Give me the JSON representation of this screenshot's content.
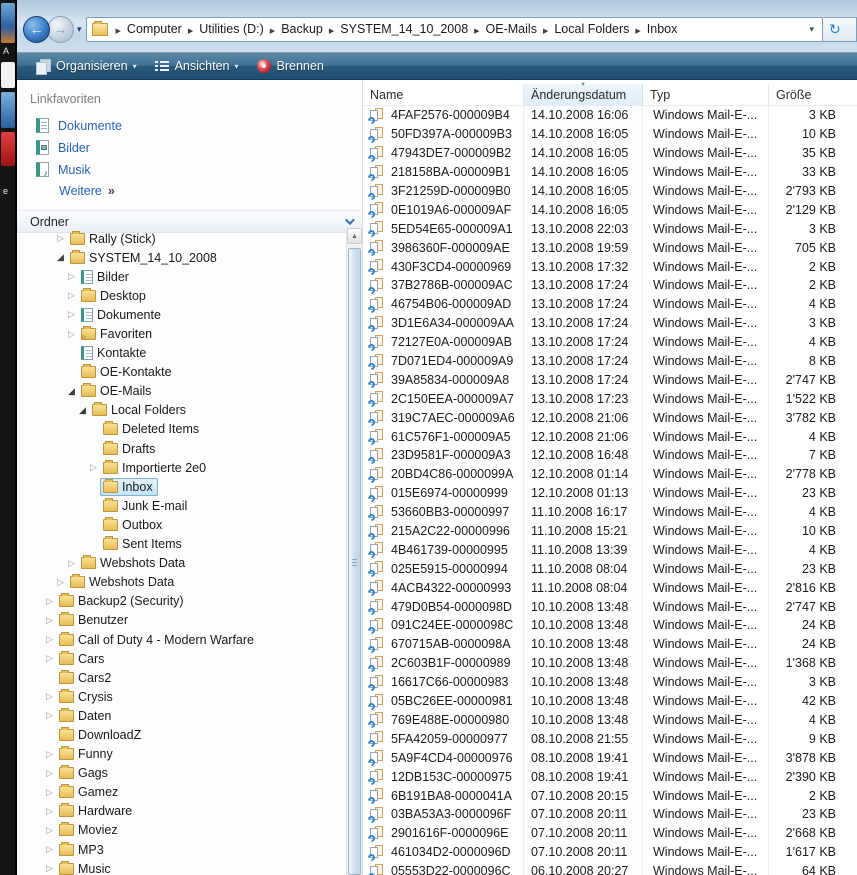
{
  "window": {
    "breadcrumb": {
      "segments": [
        "Computer",
        "Utilities (D:)",
        "Backup",
        "SYSTEM_14_10_2008",
        "OE-Mails",
        "Local Folders",
        "Inbox"
      ]
    },
    "toolbar": {
      "organize_label": "Organisieren",
      "views_label": "Ansichten",
      "burn_label": "Brennen"
    }
  },
  "sidebar": {
    "favorites_title": "Linkfavoriten",
    "favorites": [
      {
        "label": "Dokumente",
        "icon": "documents-icon"
      },
      {
        "label": "Bilder",
        "icon": "pictures-icon"
      },
      {
        "label": "Musik",
        "icon": "music-icon"
      }
    ],
    "more_label": "Weitere",
    "more_glyph": "»",
    "folders_title": "Ordner",
    "tree": [
      {
        "label": "Rally (Stick)",
        "depth": 1,
        "state": "collapsed",
        "icon": "folder"
      },
      {
        "label": "SYSTEM_14_10_2008",
        "depth": 1,
        "state": "expanded",
        "icon": "folder"
      },
      {
        "label": "Bilder",
        "depth": 2,
        "state": "collapsed",
        "icon": "page"
      },
      {
        "label": "Desktop",
        "depth": 2,
        "state": "collapsed",
        "icon": "folder"
      },
      {
        "label": "Dokumente",
        "depth": 2,
        "state": "collapsed",
        "icon": "page"
      },
      {
        "label": "Favoriten",
        "depth": 2,
        "state": "collapsed",
        "icon": "folder-star"
      },
      {
        "label": "Kontakte",
        "depth": 2,
        "state": "none",
        "icon": "page"
      },
      {
        "label": "OE-Kontakte",
        "depth": 2,
        "state": "none",
        "icon": "folder"
      },
      {
        "label": "OE-Mails",
        "depth": 2,
        "state": "expanded",
        "icon": "folder"
      },
      {
        "label": "Local Folders",
        "depth": 3,
        "state": "expanded",
        "icon": "folder"
      },
      {
        "label": "Deleted Items",
        "depth": 4,
        "state": "none",
        "icon": "folder"
      },
      {
        "label": "Drafts",
        "depth": 4,
        "state": "none",
        "icon": "folder"
      },
      {
        "label": "Importierte 2e0",
        "depth": 4,
        "state": "collapsed",
        "icon": "folder"
      },
      {
        "label": "Inbox",
        "depth": 4,
        "state": "none",
        "icon": "folder",
        "selected": true
      },
      {
        "label": "Junk E-mail",
        "depth": 4,
        "state": "none",
        "icon": "folder"
      },
      {
        "label": "Outbox",
        "depth": 4,
        "state": "none",
        "icon": "folder"
      },
      {
        "label": "Sent Items",
        "depth": 4,
        "state": "none",
        "icon": "folder"
      },
      {
        "label": "Webshots Data",
        "depth": 2,
        "state": "collapsed",
        "icon": "folder"
      },
      {
        "label": "Webshots Data",
        "depth": 1,
        "state": "collapsed",
        "icon": "folder"
      },
      {
        "label": "Backup2 (Security)",
        "depth": 0,
        "state": "collapsed",
        "icon": "folder"
      },
      {
        "label": "Benutzer",
        "depth": 0,
        "state": "collapsed",
        "icon": "folder"
      },
      {
        "label": "Call of Duty 4 - Modern Warfare",
        "depth": 0,
        "state": "collapsed",
        "icon": "folder"
      },
      {
        "label": "Cars",
        "depth": 0,
        "state": "collapsed",
        "icon": "folder"
      },
      {
        "label": "Cars2",
        "depth": 0,
        "state": "none",
        "icon": "folder"
      },
      {
        "label": "Crysis",
        "depth": 0,
        "state": "collapsed",
        "icon": "folder"
      },
      {
        "label": "Daten",
        "depth": 0,
        "state": "collapsed",
        "icon": "folder"
      },
      {
        "label": "DownloadZ",
        "depth": 0,
        "state": "none",
        "icon": "folder"
      },
      {
        "label": "Funny",
        "depth": 0,
        "state": "collapsed",
        "icon": "folder"
      },
      {
        "label": "Gags",
        "depth": 0,
        "state": "collapsed",
        "icon": "folder"
      },
      {
        "label": "Gamez",
        "depth": 0,
        "state": "collapsed",
        "icon": "folder"
      },
      {
        "label": "Hardware",
        "depth": 0,
        "state": "collapsed",
        "icon": "folder"
      },
      {
        "label": "Moviez",
        "depth": 0,
        "state": "collapsed",
        "icon": "folder"
      },
      {
        "label": "MP3",
        "depth": 0,
        "state": "collapsed",
        "icon": "folder"
      },
      {
        "label": "Music",
        "depth": 0,
        "state": "collapsed",
        "icon": "folder"
      }
    ]
  },
  "filelist": {
    "columns": [
      "Name",
      "Änderungsdatum",
      "Typ",
      "Größe"
    ],
    "sorted_column": "Änderungsdatum",
    "sort_direction": "descending",
    "type_label": "Windows Mail-E-...",
    "rows": [
      {
        "name": "4FAF2576-000009B4",
        "date": "14.10.2008 16:06",
        "size": "3 KB"
      },
      {
        "name": "50FD397A-000009B3",
        "date": "14.10.2008 16:05",
        "size": "10 KB"
      },
      {
        "name": "47943DE7-000009B2",
        "date": "14.10.2008 16:05",
        "size": "35 KB"
      },
      {
        "name": "218158BA-000009B1",
        "date": "14.10.2008 16:05",
        "size": "33 KB"
      },
      {
        "name": "3F21259D-000009B0",
        "date": "14.10.2008 16:05",
        "size": "2'793 KB"
      },
      {
        "name": "0E1019A6-000009AF",
        "date": "14.10.2008 16:05",
        "size": "2'129 KB"
      },
      {
        "name": "5ED54E65-000009A1",
        "date": "13.10.2008 22:03",
        "size": "3 KB"
      },
      {
        "name": "3986360F-000009AE",
        "date": "13.10.2008 19:59",
        "size": "705 KB"
      },
      {
        "name": "430F3CD4-00000969",
        "date": "13.10.2008 17:32",
        "size": "2 KB"
      },
      {
        "name": "37B2786B-000009AC",
        "date": "13.10.2008 17:24",
        "size": "2 KB"
      },
      {
        "name": "46754B06-000009AD",
        "date": "13.10.2008 17:24",
        "size": "4 KB"
      },
      {
        "name": "3D1E6A34-000009AA",
        "date": "13.10.2008 17:24",
        "size": "3 KB"
      },
      {
        "name": "72127E0A-000009AB",
        "date": "13.10.2008 17:24",
        "size": "4 KB"
      },
      {
        "name": "7D071ED4-000009A9",
        "date": "13.10.2008 17:24",
        "size": "8 KB"
      },
      {
        "name": "39A85834-000009A8",
        "date": "13.10.2008 17:24",
        "size": "2'747 KB"
      },
      {
        "name": "2C150EEA-000009A7",
        "date": "13.10.2008 17:23",
        "size": "1'522 KB"
      },
      {
        "name": "319C7AEC-000009A6",
        "date": "12.10.2008 21:06",
        "size": "3'782 KB"
      },
      {
        "name": "61C576F1-000009A5",
        "date": "12.10.2008 21:06",
        "size": "4 KB"
      },
      {
        "name": "23D9581F-000009A3",
        "date": "12.10.2008 16:48",
        "size": "7 KB"
      },
      {
        "name": "20BD4C86-0000099A",
        "date": "12.10.2008 01:14",
        "size": "2'778 KB"
      },
      {
        "name": "015E6974-00000999",
        "date": "12.10.2008 01:13",
        "size": "23 KB"
      },
      {
        "name": "53660BB3-00000997",
        "date": "11.10.2008 16:17",
        "size": "4 KB"
      },
      {
        "name": "215A2C22-00000996",
        "date": "11.10.2008 15:21",
        "size": "10 KB"
      },
      {
        "name": "4B461739-00000995",
        "date": "11.10.2008 13:39",
        "size": "4 KB"
      },
      {
        "name": "025E5915-00000994",
        "date": "11.10.2008 08:04",
        "size": "23 KB"
      },
      {
        "name": "4ACB4322-00000993",
        "date": "11.10.2008 08:04",
        "size": "2'816 KB"
      },
      {
        "name": "479D0B54-0000098D",
        "date": "10.10.2008 13:48",
        "size": "2'747 KB"
      },
      {
        "name": "091C24EE-0000098C",
        "date": "10.10.2008 13:48",
        "size": "24 KB"
      },
      {
        "name": "670715AB-0000098A",
        "date": "10.10.2008 13:48",
        "size": "24 KB"
      },
      {
        "name": "2C603B1F-00000989",
        "date": "10.10.2008 13:48",
        "size": "1'368 KB"
      },
      {
        "name": "16617C66-00000983",
        "date": "10.10.2008 13:48",
        "size": "3 KB"
      },
      {
        "name": "05BC26EE-00000981",
        "date": "10.10.2008 13:48",
        "size": "42 KB"
      },
      {
        "name": "769E488E-00000980",
        "date": "10.10.2008 13:48",
        "size": "4 KB"
      },
      {
        "name": "5FA42059-00000977",
        "date": "08.10.2008 21:55",
        "size": "9 KB"
      },
      {
        "name": "5A9F4CD4-00000976",
        "date": "08.10.2008 19:41",
        "size": "3'878 KB"
      },
      {
        "name": "12DB153C-00000975",
        "date": "08.10.2008 19:41",
        "size": "2'390 KB"
      },
      {
        "name": "6B191BA8-0000041A",
        "date": "07.10.2008 20:15",
        "size": "2 KB"
      },
      {
        "name": "03BA53A3-0000096F",
        "date": "07.10.2008 20:11",
        "size": "23 KB"
      },
      {
        "name": "2901616F-0000096E",
        "date": "07.10.2008 20:11",
        "size": "2'668 KB"
      },
      {
        "name": "461034D2-0000096D",
        "date": "07.10.2008 20:11",
        "size": "1'617 KB"
      },
      {
        "name": "05553D22-0000096C",
        "date": "06.10.2008 20:27",
        "size": "64 KB"
      }
    ]
  }
}
